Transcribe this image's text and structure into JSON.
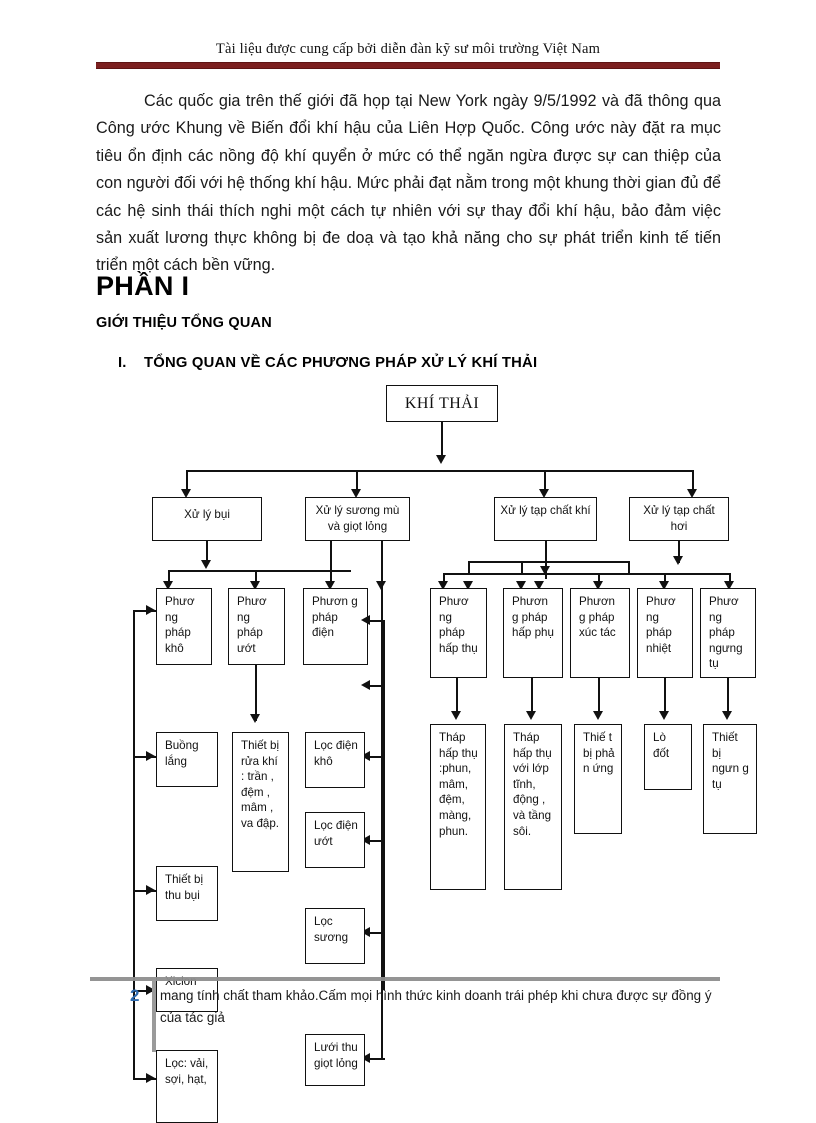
{
  "header": {
    "text": "Tài liệu được cung cấp bởi diễn đàn kỹ sư môi trường Việt Nam"
  },
  "body": {
    "paragraph": "Các quốc gia trên thế giới đã họp tại New York ngày 9/5/1992 và đã thông qua Công ước Khung về Biến đổi khí hậu của Liên Hợp Quốc. Công ước này đặt ra mục tiêu ổn định các nồng độ khí quyển ở mức có thể ngăn ngừa được sự can thiệp của con người đối với hệ thống khí hậu. Mức phải đạt nằm trong một khung thời gian đủ để các hệ sinh thái thích nghi một cách tự nhiên với sự thay đổi khí hậu, bảo đảm việc sản xuất lương thực không bị đe doạ và tạo khả năng cho sự phát triển kinh tế tiến triển một cách bền vững.",
    "heading_part": "PHẦN I",
    "heading_section": "GIỚI THIỆU TỔNG QUAN",
    "heading_sub_number": "I.",
    "heading_sub": "TỔNG QUAN VỀ CÁC PHƯƠNG PHÁP XỬ LÝ KHÍ THẢI"
  },
  "chart_data": {
    "type": "diagram",
    "title": "KHÍ THẢI",
    "nodes": {
      "root": "KHÍ THẢI",
      "level1": [
        "Xử  lý  bụi",
        "Xử lý sương mù và giọt lỏng",
        "Xử lý tạp chất khí",
        "Xử lý tạp chất hơi"
      ],
      "level2_left": [
        "Phươ ng pháp khô",
        "Phươ ng pháp ướt",
        "Phươn g pháp điện"
      ],
      "level2_right": [
        "Phươ ng pháp hấp thụ",
        "Phươn g pháp hấp phụ",
        "Phươn g pháp xúc tác",
        "Phươ ng pháp nhiệt",
        "Phươ ng pháp ngưng tụ"
      ],
      "level3_left": [
        "Buồng lắng",
        "Thiết bị  rửa khí    : trần   , đệm   , mâm  , va đập.",
        "Lọc điện khô",
        "Lọc điện ướt",
        "Thiết bị thu bụi",
        "Lọc sương",
        "Xiclon",
        "Lưới thu giọt lỏng",
        "Lọc: vải, sợi, hạt,"
      ],
      "level3_right": [
        "Tháp hấp thụ :phun, mâm, đệm, màng, phun.",
        "Tháp hấp thụ với lớp tĩnh, động , và tầng sôi.",
        "Thiế t  bị phả n ứng",
        "Lò đốt",
        "Thiết bị ngưn g tụ"
      ]
    }
  },
  "footer": {
    "page_number": "2",
    "text": "mang tính chất tham khảo.Cấm mọi hình thức kinh doanh trái phép khi chưa được sự đồng ý của tác giả"
  }
}
